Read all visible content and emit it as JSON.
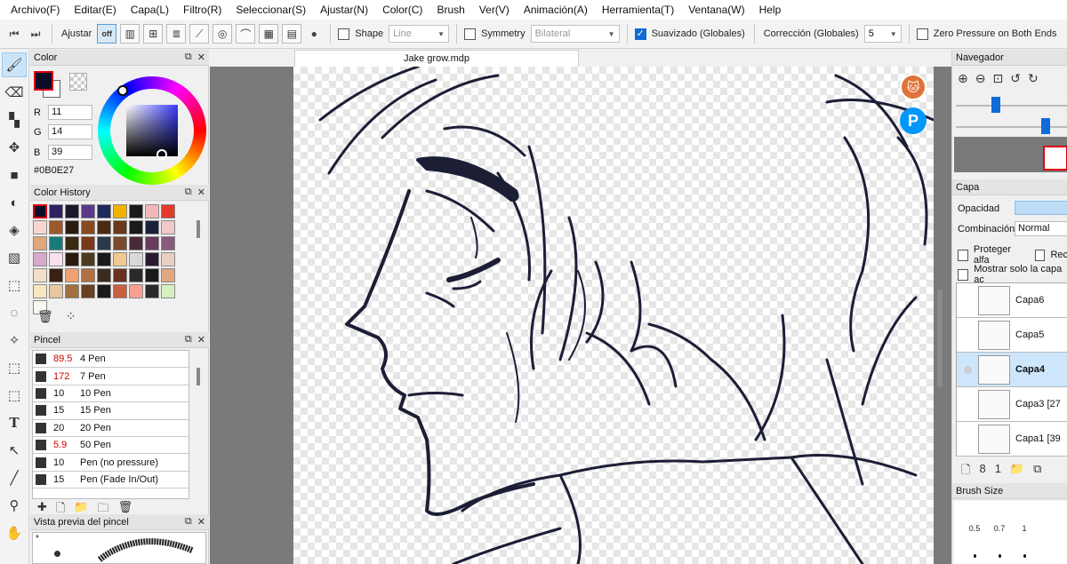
{
  "menu": [
    "Archivo(F)",
    "Editar(E)",
    "Capa(L)",
    "Filtro(R)",
    "Seleccionar(S)",
    "Ajustar(N)",
    "Color(C)",
    "Brush",
    "Ver(V)",
    "Animación(A)",
    "Herramienta(T)",
    "Ventana(W)",
    "Help"
  ],
  "toolbar": {
    "ajustar_label": "Ajustar",
    "off_label": "off",
    "shape_label": "Shape",
    "shape_value": "Line",
    "symmetry_label": "Symmetry",
    "symmetry_value": "Bilateral",
    "suavizado_label": "Suavizado (Globales)",
    "correccion_label": "Corrección (Globales)",
    "correccion_value": "5",
    "zero_pressure_label": "Zero Pressure on Both Ends"
  },
  "color_panel": {
    "title": "Color",
    "r_label": "R",
    "r": "11",
    "g_label": "G",
    "g": "14",
    "b_label": "B",
    "b": "39",
    "hex": "#0B0E27",
    "fg_color": "#0b0e27"
  },
  "history_panel": {
    "title": "Color History",
    "colors": [
      "#0b0e27",
      "#2f2160",
      "#1a1a2a",
      "#5b3a8c",
      "#1e2a5c",
      "#f0b400",
      "#1a1a1a",
      "#f2b8b8",
      "#e23a2a",
      "#f6d8d0",
      "#9b5a2a",
      "#2a1a10",
      "#8a4a20",
      "#4a2a10",
      "#6a3a1a",
      "#1a1a1a",
      "#1a1f3a",
      "#f2c8c8",
      "#e0a878",
      "#1a7a7a",
      "#3a2a10",
      "#7a3a1a",
      "#2a3a4a",
      "#7a4a2a",
      "#4a2a3a",
      "#6a3a5a",
      "#8a5a7a",
      "#d8a8c8",
      "#f8e0f0",
      "#2a1a10",
      "#4a3a20",
      "#1a1a1a",
      "#f0c890",
      "#d8d8d8",
      "#2a1a30",
      "#e8d0c0",
      "#f0e0c8",
      "#3a2010",
      "#f0a070",
      "#b07040",
      "#3a2a20",
      "#6a3020",
      "#2a2a2a",
      "#1a1a1a",
      "#e0a880",
      "#f8e8c0",
      "#e8c8a0",
      "#a07040",
      "#6a4020",
      "#1a1a1a",
      "#c86040",
      "#f8a090",
      "#2a2a2a",
      "#d8f0c0",
      "#f8f8f0"
    ]
  },
  "brush_panel": {
    "title": "Pincel",
    "items": [
      {
        "size": "89.5",
        "name": "4 Pen",
        "red": true
      },
      {
        "size": "172",
        "name": "7 Pen",
        "red": true
      },
      {
        "size": "10",
        "name": "10 Pen",
        "red": false
      },
      {
        "size": "15",
        "name": "15 Pen",
        "red": false
      },
      {
        "size": "20",
        "name": "20 Pen",
        "red": false
      },
      {
        "size": "5.9",
        "name": "50 Pen",
        "red": true
      },
      {
        "size": "10",
        "name": "Pen (no pressure)",
        "red": false
      },
      {
        "size": "15",
        "name": "Pen (Fade In/Out)",
        "red": false
      }
    ]
  },
  "preview_panel": {
    "title": "Vista previa del pincel",
    "marker": "*"
  },
  "document": {
    "tab_title": "Jake grow.mdp",
    "pixiv_letter": "P"
  },
  "navigator": {
    "title": "Navegador"
  },
  "layer_panel": {
    "title": "Capa",
    "opacity_label": "Opacidad",
    "blend_label": "Combinación",
    "blend_value": "Normal",
    "protect_alpha_label": "Proteger alfa",
    "clip_label_partial": "Rec",
    "show_only_label": "Mostrar solo la capa ac",
    "layers": [
      {
        "name": "Capa6",
        "selected": false
      },
      {
        "name": "Capa5",
        "selected": false
      },
      {
        "name": "Capa4",
        "selected": true
      },
      {
        "name": "Capa3 [27",
        "selected": false
      },
      {
        "name": "Capa1 [39",
        "selected": false
      }
    ]
  },
  "brush_size": {
    "title": "Brush Size",
    "sizes": [
      "0.5",
      "0.7",
      "1"
    ]
  }
}
